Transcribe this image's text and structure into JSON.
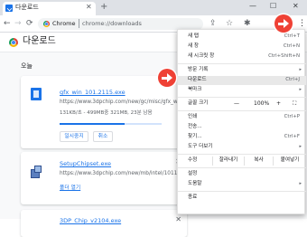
{
  "tab": {
    "title": "다운로드",
    "close_glyph": "✕",
    "new_tab_glyph": "+"
  },
  "window": {
    "minimize": "—",
    "maximize": "☐",
    "close": "✕"
  },
  "toolbar": {
    "back": "←",
    "forward": "→",
    "reload": "⟳",
    "url_scheme": "Chrome",
    "url_path": "chrome://downloads",
    "share_icon": "⇪",
    "star_icon": "☆",
    "extension_icon": "✱",
    "menu_icon": "⋮"
  },
  "page": {
    "title": "다운로드",
    "date_header": "오늘",
    "downloads": [
      {
        "filename": "gfx_win_101.2115.exe",
        "url": "https://www.3dpchip.com/new/gc/misc/gfx_win_101...",
        "status": "131KB/초 - 499MB중 321MB, 23분 남음",
        "progress": 0.64,
        "pause_label": "일시중지",
        "cancel_label": "취소"
      },
      {
        "filename": "SetupChipset.exe",
        "url": "https://www.3dpchip.com/new/mb/intel/1011928/...",
        "open_folder_label": "폴더 열기",
        "remove_glyph": "✕"
      },
      {
        "filename": "3DP_Chip_v2104.exe",
        "remove_glyph": "✕"
      }
    ]
  },
  "menu": {
    "items": [
      {
        "label": "새 탭",
        "shortcut": "Ctrl+T"
      },
      {
        "label": "새 창",
        "shortcut": "Ctrl+N"
      },
      {
        "label": "새 시크릿 창",
        "shortcut": "Ctrl+Shift+N"
      },
      {
        "label": "방문 기록",
        "shortcut": "",
        "submenu": true
      },
      {
        "label": "다운로드",
        "shortcut": "Ctrl+J",
        "highlighted": true
      },
      {
        "label": "북마크",
        "shortcut": "",
        "submenu": true
      }
    ],
    "zoom": {
      "label": "글꼴 크기",
      "minus": "—",
      "value": "100%",
      "plus": "+",
      "fullscreen": "⛶"
    },
    "items2": [
      {
        "label": "인쇄",
        "shortcut": "Ctrl+P"
      },
      {
        "label": "전송...",
        "shortcut": ""
      },
      {
        "label": "찾기...",
        "shortcut": "Ctrl+F"
      },
      {
        "label": "도구 더보기",
        "shortcut": "",
        "submenu": true
      }
    ],
    "edit": {
      "label": "수정",
      "cut": "잘라내기",
      "copy": "복사",
      "paste": "붙여넣기"
    },
    "items3": [
      {
        "label": "설정",
        "shortcut": ""
      },
      {
        "label": "도움말",
        "shortcut": "",
        "submenu": true
      }
    ],
    "exit": {
      "label": "종료"
    },
    "submenu_arrow": "▸"
  },
  "colors": {
    "accent": "#1a73e8",
    "highlight_arrow": "#ef4135"
  }
}
